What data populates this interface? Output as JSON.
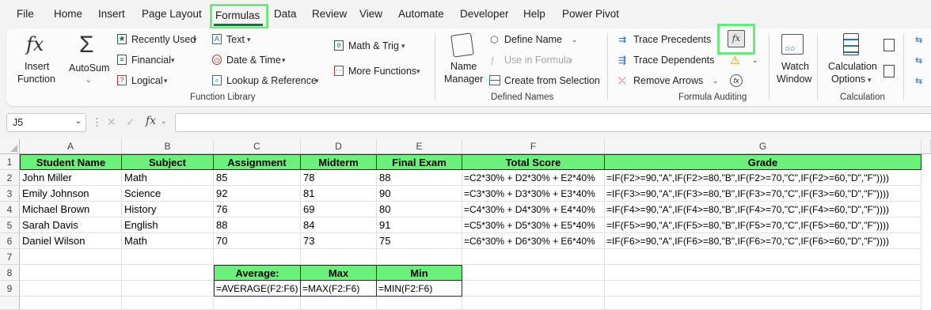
{
  "menu": [
    "File",
    "Home",
    "Insert",
    "Page Layout",
    "Formulas",
    "Data",
    "Review",
    "View",
    "Automate",
    "Developer",
    "Help",
    "Power Pivot"
  ],
  "ribbon": {
    "insert_function": [
      "Insert",
      "Function"
    ],
    "autosum": "AutoSum",
    "recently_used": "Recently Used",
    "financial": "Financial",
    "logical": "Logical",
    "text": "Text",
    "date_time": "Date & Time",
    "lookup": "Lookup & Reference",
    "math_trig": "Math & Trig",
    "more_functions": "More Functions",
    "function_library": "Function Library",
    "name_manager": [
      "Name",
      "Manager"
    ],
    "define_name": "Define Name",
    "use_in_formula": "Use in Formula",
    "create_from_selection": "Create from Selection",
    "defined_names": "Defined Names",
    "trace_precedents": "Trace Precedents",
    "trace_dependents": "Trace Dependents",
    "remove_arrows": "Remove Arrows",
    "formula_auditing": "Formula Auditing",
    "watch_window": [
      "Watch",
      "Window"
    ],
    "calc_options": [
      "Calculation",
      "Options"
    ],
    "calculation": "Calculation"
  },
  "formula_bar": {
    "name_box": "J5",
    "content": ""
  },
  "columns": [
    {
      "letter": "A"
    },
    {
      "letter": "B"
    },
    {
      "letter": "C"
    },
    {
      "letter": "D"
    },
    {
      "letter": "E"
    },
    {
      "letter": "F"
    },
    {
      "letter": "G"
    }
  ],
  "rows": [
    "1",
    "2",
    "3",
    "4",
    "5",
    "6",
    "7",
    "8",
    "9"
  ],
  "table": {
    "headers": [
      "Student Name",
      "Subject",
      "Assignment",
      "Midterm",
      "Final Exam",
      "Total Score",
      "Grade"
    ],
    "data": [
      [
        "John Miller",
        "Math",
        "85",
        "78",
        "88",
        "=C2*30% + D2*30% + E2*40%",
        "=IF(F2>=90,\"A\",IF(F2>=80,\"B\",IF(F2>=70,\"C\",IF(F2>=60,\"D\",\"F\"))))"
      ],
      [
        "Emily Johnson",
        "Science",
        "92",
        "81",
        "90",
        "=C3*30% + D3*30% + E3*40%",
        "=IF(F3>=90,\"A\",IF(F3>=80,\"B\",IF(F3>=70,\"C\",IF(F3>=60,\"D\",\"F\"))))"
      ],
      [
        "Michael Brown",
        "History",
        "76",
        "69",
        "80",
        "=C4*30% + D4*30% + E4*40%",
        "=IF(F4>=90,\"A\",IF(F4>=80,\"B\",IF(F4>=70,\"C\",IF(F4>=60,\"D\",\"F\"))))"
      ],
      [
        "Sarah Davis",
        "English",
        "88",
        "84",
        "91",
        "=C5*30% + D5*30% + E5*40%",
        "=IF(F5>=90,\"A\",IF(F5>=80,\"B\",IF(F5>=70,\"C\",IF(F5>=60,\"D\",\"F\"))))"
      ],
      [
        "Daniel Wilson",
        "Math",
        "70",
        "73",
        "75",
        "=C6*30% + D6*30% + E6*40%",
        "=IF(F6>=90,\"A\",IF(F6>=80,\"B\",IF(F6>=70,\"C\",IF(F6>=60,\"D\",\"F\"))))"
      ]
    ]
  },
  "summary": {
    "headers": [
      "Average:",
      "Max",
      "Min"
    ],
    "values": [
      "=AVERAGE(F2:F6)",
      "=MAX(F2:F6)",
      "=MIN(F2:F6)"
    ]
  },
  "colors": {
    "header_fill": "#6bf17b",
    "highlight": "#6be87f",
    "excel_green": "#1e6b3c"
  }
}
